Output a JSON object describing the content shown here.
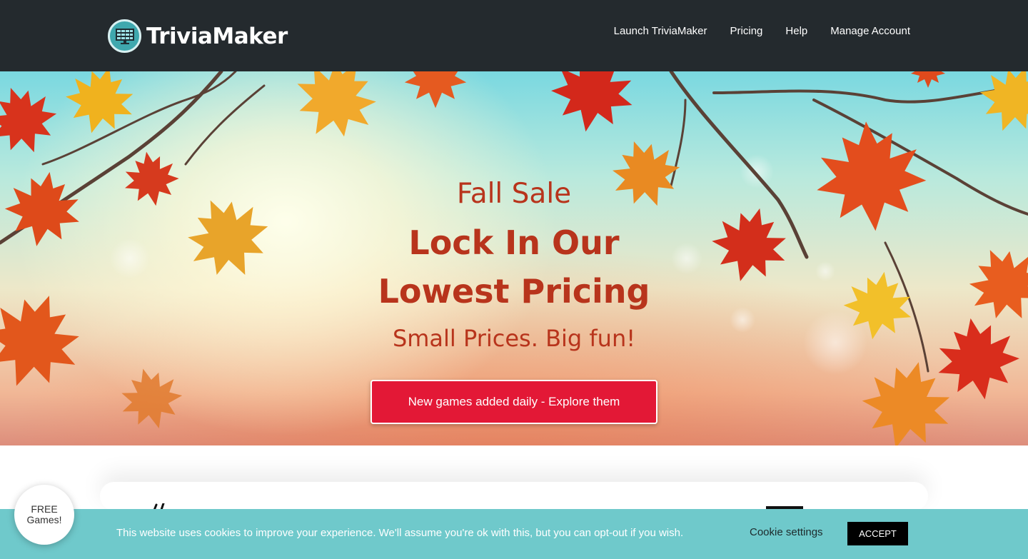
{
  "header": {
    "brand": "TriviaMaker",
    "logo_icon": "grid-board-icon",
    "nav": [
      {
        "label": "Launch TriviaMaker"
      },
      {
        "label": "Pricing"
      },
      {
        "label": "Help"
      },
      {
        "label": "Manage Account"
      }
    ]
  },
  "hero": {
    "eyebrow": "Fall Sale",
    "headline_line1": "Lock In Our",
    "headline_line2": "Lowest Pricing",
    "subline": "Small Prices. Big fun!",
    "cta_label": "New games added daily - Explore them"
  },
  "cookie_bar": {
    "message": "This website uses cookies to improve your experience. We'll assume you're ok with this, but you can opt-out if you wish.",
    "settings_label": "Cookie settings",
    "accept_label": "ACCEPT"
  },
  "free_bubble": {
    "line1": "FREE",
    "line2": "Games!"
  },
  "colors": {
    "header_bg": "#242a2e",
    "accent_red": "#e31836",
    "hero_text": "#b8341c",
    "cookie_bg": "#6fc9cb"
  }
}
